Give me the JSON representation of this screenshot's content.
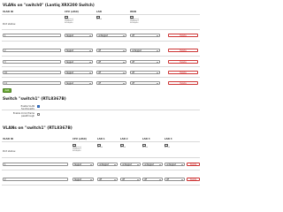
{
  "vlan_switch0": {
    "title": "VLANs on \"switch0\" (Lantiq XRX200 Switch)",
    "headers": [
      "VLAN ID",
      "CPU (eth0)",
      "LAN",
      "WAN"
    ],
    "port_status": {
      "label": "Port status:",
      "cpu": [
        "connected",
        "1000baseT",
        "full-duplex"
      ],
      "lan": [
        "no link"
      ],
      "wan": [
        "connected",
        "1000baseT",
        "full-duplex"
      ]
    },
    "rows": [
      {
        "vid": "1",
        "cpu": "tagged",
        "lan": "untagged",
        "wan": "off",
        "action": "Delete"
      },
      {
        "vid": "2",
        "cpu": "tagged",
        "lan": "off",
        "wan": "untagged",
        "action": "Delete"
      },
      {
        "vid": "3",
        "cpu": "tagged",
        "lan": "off",
        "wan": "off",
        "action": "Delete"
      },
      {
        "vid": "10",
        "cpu": "tagged",
        "lan": "off",
        "wan": "off",
        "action": "Delete"
      },
      {
        "vid": "11",
        "cpu": "tagged",
        "lan": "off",
        "wan": "off",
        "action": "Delete"
      }
    ],
    "add_label": "Add"
  },
  "switch1": {
    "title": "Switch \"switch1\" (RTL8367B)",
    "options": [
      {
        "label": "Enable VLAN functionality",
        "checked": true
      },
      {
        "label": "Enable mirror/frame passthrough",
        "checked": false
      }
    ]
  },
  "vlan_switch1": {
    "title": "VLANs on \"switch1\" (RTL8367B)",
    "headers": [
      "VLAN ID",
      "CPU (eth0)",
      "LAN 1",
      "LAN 2",
      "LAN 3",
      "LAN 4"
    ],
    "port_status": {
      "label": "Port status:",
      "cpu": [
        "connected",
        "1000baseT",
        "full-duplex"
      ],
      "lan1": [
        "no link"
      ],
      "lan2": [
        "no link"
      ],
      "lan3": [
        "no link"
      ],
      "lan4": [
        "no link"
      ]
    },
    "rows": [
      {
        "vid": "1",
        "cpu": "tagged",
        "lan1": "untagged",
        "lan2": "untagged",
        "lan3": "untagged",
        "lan4": "untagged",
        "action": "Delete"
      },
      {
        "vid": "2",
        "cpu": "tagged",
        "lan1": "off",
        "lan2": "off",
        "lan3": "off",
        "lan4": "off",
        "action": "Delete"
      }
    ]
  },
  "colors": {
    "delete": "#cc3333",
    "add": "#6aa935",
    "checkbox": "#3b7ddd"
  }
}
